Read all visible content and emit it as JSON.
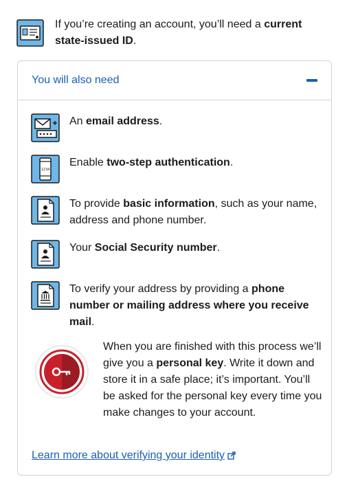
{
  "intro": {
    "text_pre": "If you’re creating an account, you’ll need a ",
    "text_bold": "current state-issued ID",
    "text_post": ".",
    "icon": "id-card-icon"
  },
  "panel": {
    "title": "You will also need",
    "toggle_icon": "minus-icon",
    "items": [
      {
        "icon": "email-icon",
        "pre": "An ",
        "bold": "email address",
        "post": "."
      },
      {
        "icon": "phone-icon",
        "pre": "Enable ",
        "bold": "two-step authentication",
        "post": ".",
        "icon_text": "1234"
      },
      {
        "icon": "document-person-icon",
        "pre": "To provide ",
        "bold": "basic information",
        "post": ", such as your name, address and phone number."
      },
      {
        "icon": "document-person-icon",
        "pre": "Your ",
        "bold": "Social Security number",
        "post": "."
      },
      {
        "icon": "document-building-icon",
        "pre": "To verify your address by providing a ",
        "bold": "phone number or mailing address where you receive mail",
        "post": "."
      }
    ],
    "key": {
      "icon": "personal-key-icon",
      "pre": "When you are finished with this process we’ll give you a ",
      "bold": "personal key",
      "post": ". Write it down and store it in a safe place; it’s important. You’ll be asked for the personal key every time you make changes to your account."
    },
    "link": {
      "label": "Learn more about verifying your identity",
      "icon": "external-link-icon"
    }
  },
  "colors": {
    "link": "#1a5fb4",
    "icon_bg": "#6fb7e8",
    "key_red": "#c8202b",
    "border": "#cfd3d8"
  }
}
